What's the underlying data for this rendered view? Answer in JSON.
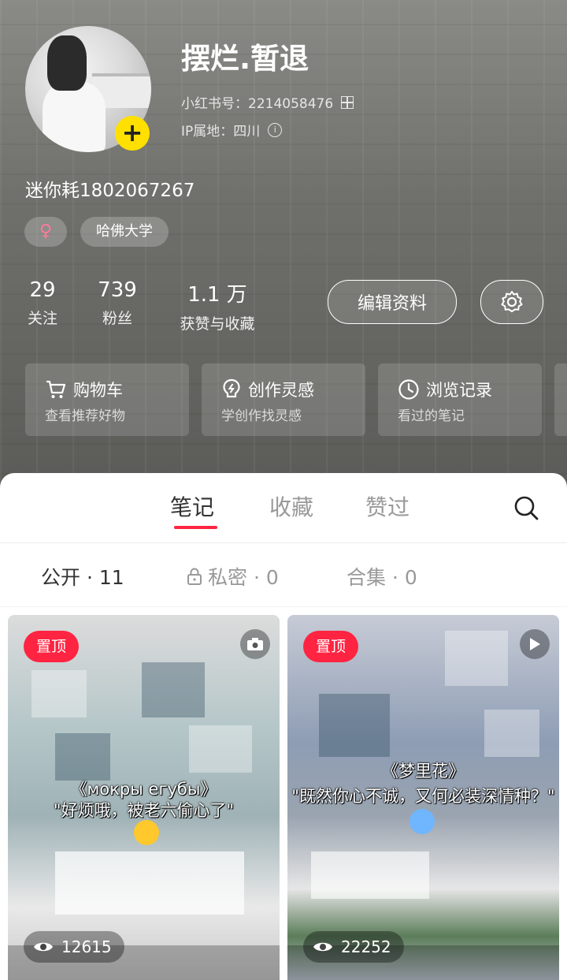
{
  "profile": {
    "name": "摆烂.暂退",
    "red_id_label": "小红书号：",
    "red_id": "2214058476",
    "ip_label": "IP属地：",
    "ip_value": "四川",
    "bio": "迷你耗1802067267",
    "gender_symbol": "♀",
    "school_tag": "哈佛大学",
    "add_symbol": "+"
  },
  "stats": [
    {
      "value": "29",
      "label": "关注"
    },
    {
      "value": "739",
      "label": "粉丝"
    },
    {
      "value": "1.1 万",
      "label": "获赞与收藏"
    }
  ],
  "actions": {
    "edit_profile": "编辑资料"
  },
  "features": [
    {
      "title": "购物车",
      "subtitle": "查看推荐好物",
      "icon": "cart-icon"
    },
    {
      "title": "创作灵感",
      "subtitle": "学创作找灵感",
      "icon": "lightbulb-icon"
    },
    {
      "title": "浏览记录",
      "subtitle": "看过的笔记",
      "icon": "clock-icon"
    }
  ],
  "tabs": [
    {
      "label": "笔记",
      "active": true
    },
    {
      "label": "收藏",
      "active": false
    },
    {
      "label": "赞过",
      "active": false
    }
  ],
  "subtabs": [
    {
      "label": "公开 · 11",
      "active": true
    },
    {
      "label": "私密 · 0",
      "active": false,
      "icon": "lock-icon"
    },
    {
      "label": "合集 · 0",
      "active": false
    }
  ],
  "notes": [
    {
      "pin_label": "置顶",
      "overlay_line1": "《мокры eгубы》",
      "overlay_line2": "\"好烦哦，被老六偷心了\"",
      "views": "12615",
      "media": "camera-icon"
    },
    {
      "pin_label": "置顶",
      "overlay_line1": "《梦里花》",
      "overlay_line2": "\"既然你心不诚，又何必装深情种？\"",
      "views": "22252",
      "media": "play-icon"
    }
  ],
  "colors": {
    "accent": "#ff2442",
    "badge_yellow": "#ffe000"
  }
}
